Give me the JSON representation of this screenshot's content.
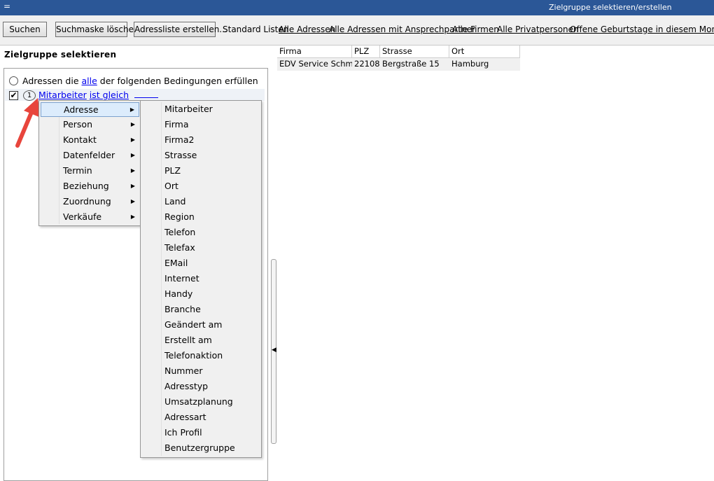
{
  "window": {
    "title": "Zielgruppe selektieren/erstellen",
    "sysmenu_glyph": "="
  },
  "toolbar": {
    "search_label": "Suchen",
    "clear_label": "Suchmaske löschen",
    "create_list_label": "Adressliste erstellen...",
    "standard_lists_label": "Standard Listen",
    "links": [
      "Alle Adressen",
      "Alle Adressen mit Ansprechpartner",
      "Alle Firmen",
      "Alle Privatpersonen",
      "Offene Geburtstage in diesem Monat"
    ]
  },
  "left_panel": {
    "title": "Zielgruppe selektieren",
    "condition": {
      "prefix": "Adressen die",
      "link": "alle",
      "suffix": "der folgenden Bedingungen erfüllen"
    },
    "row1": {
      "checked": true,
      "number": "1",
      "field": "Mitarbeiter",
      "operator": "ist gleich"
    }
  },
  "menu_level1": {
    "items": [
      "Adresse",
      "Person",
      "Kontakt",
      "Datenfelder",
      "Termin",
      "Beziehung",
      "Zuordnung",
      "Verkäufe"
    ],
    "active_index": 0
  },
  "menu_level2": {
    "items": [
      "Mitarbeiter",
      "Firma",
      "Firma2",
      "Strasse",
      "PLZ",
      "Ort",
      "Land",
      "Region",
      "Telefon",
      "Telefax",
      "EMail",
      "Internet",
      "Handy",
      "Branche",
      "Geändert am",
      "Erstellt am",
      "Telefonaktion",
      "Nummer",
      "Adresstyp",
      "Umsatzplanung",
      "Adressart",
      "Ich Profil",
      "Benutzergruppe"
    ]
  },
  "results_grid": {
    "columns": [
      "Firma",
      "PLZ",
      "Strasse",
      "Ort"
    ],
    "rows": [
      [
        "EDV Service Schmitt",
        "22108",
        "Bergstraße 15",
        "Hamburg"
      ]
    ]
  },
  "colors": {
    "titlebar": "#2b5797",
    "link": "#0000ee",
    "annotation_arrow": "#e8453c",
    "menu_highlight": "#dcecfc"
  }
}
